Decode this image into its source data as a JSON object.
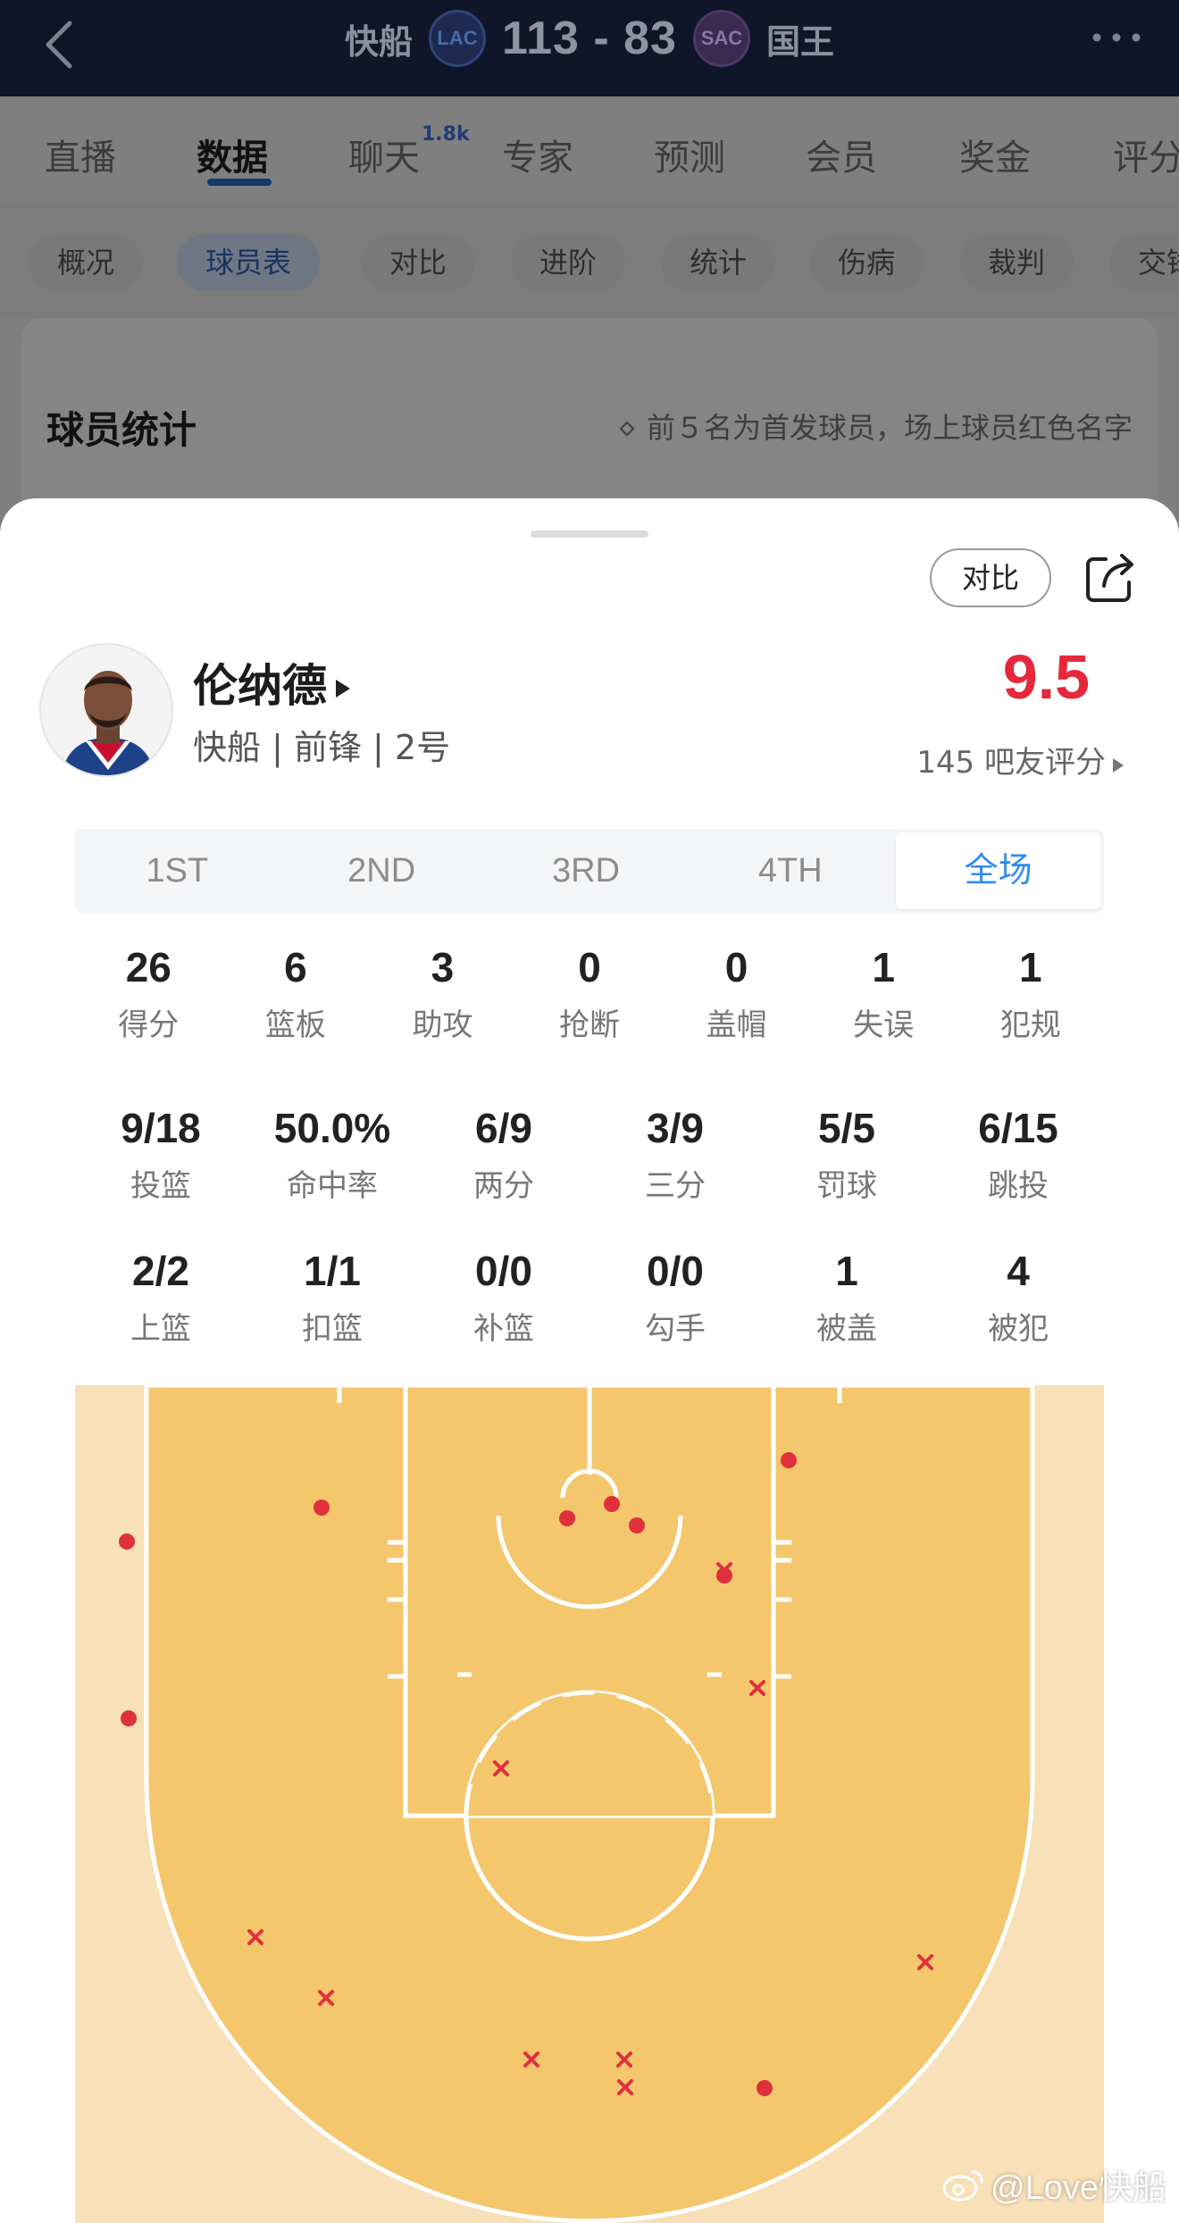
{
  "header": {
    "home_team": "快船",
    "home_logo": "LAC",
    "score": "113 - 83",
    "away_logo": "SAC",
    "away_team": "国王"
  },
  "tabs": [
    {
      "label": "直播"
    },
    {
      "label": "数据",
      "active": true
    },
    {
      "label": "聊天",
      "badge": "1.8k"
    },
    {
      "label": "专家"
    },
    {
      "label": "预测"
    },
    {
      "label": "会员"
    },
    {
      "label": "奖金"
    },
    {
      "label": "评分"
    }
  ],
  "subtabs": [
    {
      "label": "概况"
    },
    {
      "label": "球员表",
      "active": true
    },
    {
      "label": "对比"
    },
    {
      "label": "进阶"
    },
    {
      "label": "统计"
    },
    {
      "label": "伤病"
    },
    {
      "label": "裁判"
    },
    {
      "label": "交锋"
    }
  ],
  "stats_card": {
    "title": "球员统计",
    "note": "前５名为首发球员，场上球员红色名字"
  },
  "sheet": {
    "compare_label": "对比",
    "player_name": "伦纳德",
    "player_meta": "快船 | 前锋 | 2号",
    "rating": "9.5",
    "rating_count": "145 吧友评分",
    "periods": [
      "1ST",
      "2ND",
      "3RD",
      "4TH",
      "全场"
    ],
    "active_period": "全场",
    "row1": [
      {
        "value": "26",
        "label": "得分"
      },
      {
        "value": "6",
        "label": "篮板"
      },
      {
        "value": "3",
        "label": "助攻"
      },
      {
        "value": "0",
        "label": "抢断"
      },
      {
        "value": "0",
        "label": "盖帽"
      },
      {
        "value": "1",
        "label": "失误"
      },
      {
        "value": "1",
        "label": "犯规"
      }
    ],
    "row2": [
      {
        "value": "9/18",
        "label": "投篮"
      },
      {
        "value": "50.0%",
        "label": "命中率"
      },
      {
        "value": "6/9",
        "label": "两分"
      },
      {
        "value": "3/9",
        "label": "三分"
      },
      {
        "value": "5/5",
        "label": "罚球"
      },
      {
        "value": "6/15",
        "label": "跳投"
      }
    ],
    "row3": [
      {
        "value": "2/2",
        "label": "上篮"
      },
      {
        "value": "1/1",
        "label": "扣篮"
      },
      {
        "value": "0/0",
        "label": "补篮"
      },
      {
        "value": "0/0",
        "label": "勾手"
      },
      {
        "value": "1",
        "label": "被盖"
      },
      {
        "value": "4",
        "label": "被犯"
      }
    ]
  },
  "shot_chart": {
    "made_color": "#e0303d",
    "missed_color": "#e0303d",
    "court_inner_color": "#f4c76d",
    "court_outer_color": "#f8e0b8"
  },
  "watermark": "@Love快船",
  "colors": {
    "rating_red": "#e5283a",
    "active_period_blue": "#2d8cf0",
    "topbar_bg": "#0f1629"
  }
}
